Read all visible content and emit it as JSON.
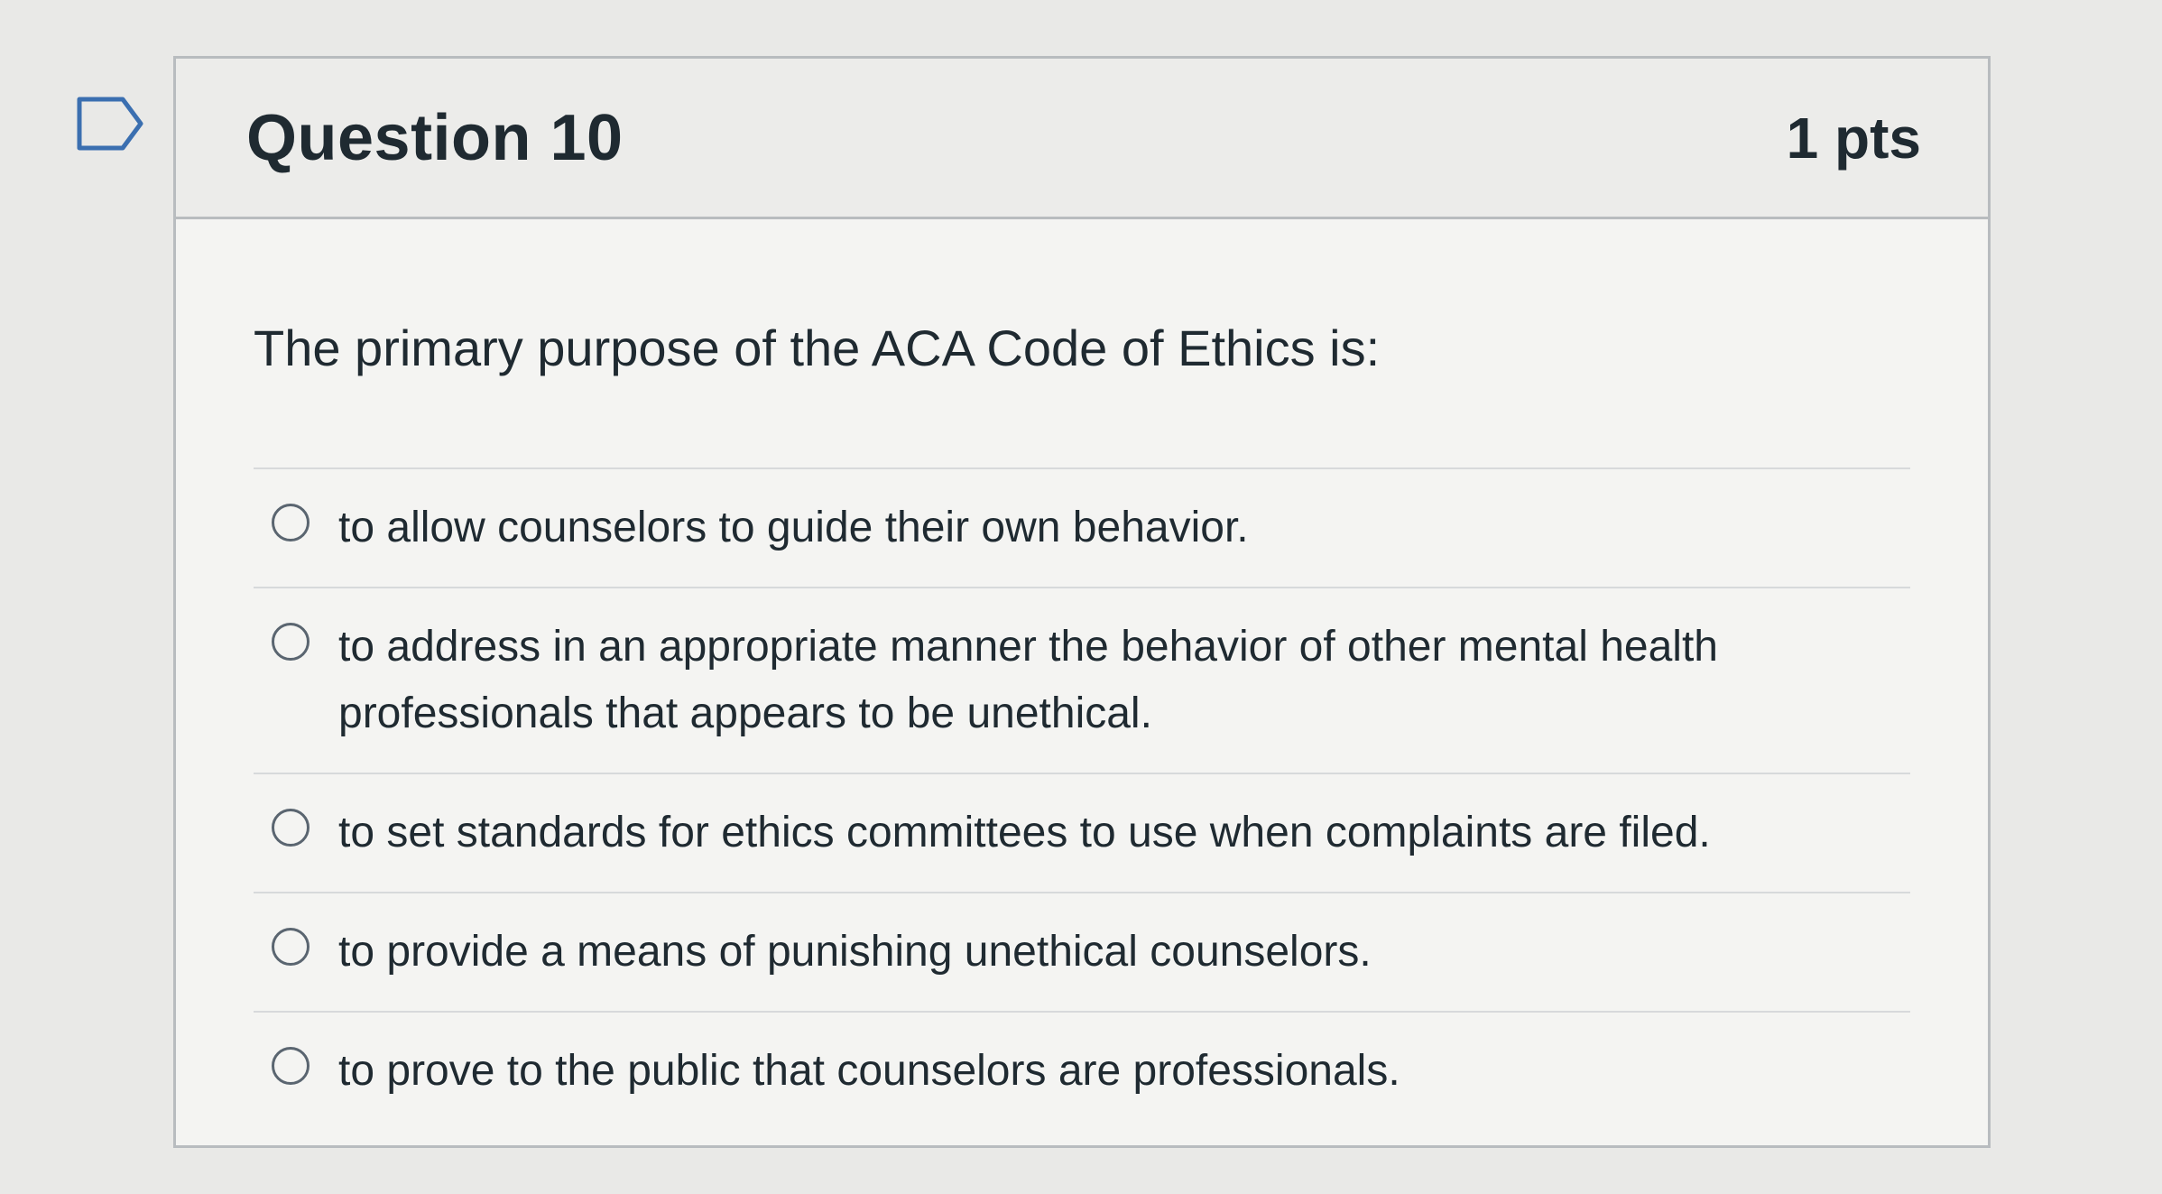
{
  "question": {
    "title": "Question 10",
    "points": "1 pts",
    "text": "The primary purpose of the ACA Code of Ethics is:",
    "flag_icon": "flag-outline-icon"
  },
  "answers": [
    {
      "label": "to allow counselors to guide their own behavior.",
      "selected": false
    },
    {
      "label": "to address in an appropriate manner the behavior of other mental health professionals that appears to be unethical.",
      "selected": false
    },
    {
      "label": "to set standards for ethics committees to use when complaints are filed.",
      "selected": false
    },
    {
      "label": "to provide a means of punishing unethical counselors.",
      "selected": false
    },
    {
      "label": "to prove to the public that counselors are professionals.",
      "selected": false
    }
  ],
  "colors": {
    "border": "#b8bcbf",
    "text": "#1f2a31",
    "background": "#e9e9e7"
  }
}
